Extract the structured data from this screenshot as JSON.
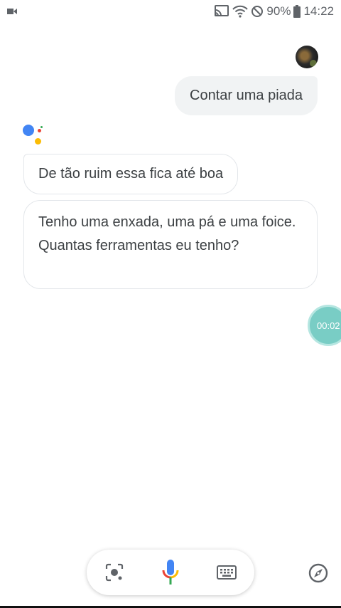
{
  "status_bar": {
    "battery": "90%",
    "time": "14:22",
    "icons": [
      "screen-record-icon",
      "cast-icon",
      "wifi-icon",
      "do-not-disturb-icon",
      "battery-icon"
    ]
  },
  "conversation": {
    "user_query": "Contar uma piada",
    "assistant_responses": [
      "De tão ruim essa fica até boa",
      "Tenho uma enxada, uma pá e uma foice. Quantas ferramentas eu tenho?"
    ]
  },
  "timer": {
    "label": "00:02"
  },
  "bottom_bar": {
    "icons": [
      "lens-icon",
      "mic-icon",
      "keyboard-icon",
      "explore-icon"
    ]
  },
  "colors": {
    "google_blue": "#4285f4",
    "google_red": "#ea4335",
    "google_yellow": "#fbbc04",
    "google_green": "#34a853",
    "timer_teal": "#79cdc5",
    "bubble_gray": "#f1f3f4"
  }
}
